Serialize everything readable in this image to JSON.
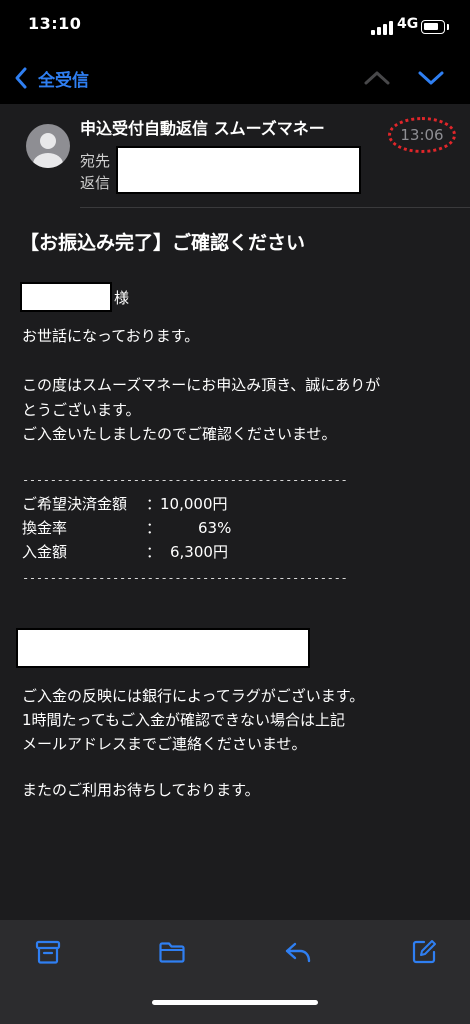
{
  "status_bar": {
    "time": "13:10",
    "network": "4G"
  },
  "nav": {
    "back_label": "全受信",
    "up_icon": "chevron-up-icon",
    "down_icon": "chevron-down-icon"
  },
  "header": {
    "sender": "申込受付自動返信 スムーズマネー",
    "time": "13:06",
    "to_label": "宛先",
    "reply_label": "返信"
  },
  "message": {
    "subject": "【お振込み完了】ご確認ください",
    "honorific": "様",
    "greeting": "お世話になっております。",
    "thanks_line1": "この度はスムーズマネーにお申込み頂き、誠にありが",
    "thanks_line2": "とうございます。",
    "confirm_line": "ご入金いたしましたのでご確認くださいませ。",
    "separator": "-----------------------------------------------",
    "details": [
      {
        "label": "ご希望決済金額",
        "value": "10,000円"
      },
      {
        "label": "換金率",
        "value": "63%"
      },
      {
        "label": "入金額",
        "value": "6,300円"
      }
    ],
    "detail_colon": "：",
    "note_line1": "ご入金の反映には銀行によってラグがございます。",
    "note_line2": "1時間たってもご入金が確認できない場合は上記",
    "note_line3": "メールアドレスまでご連絡くださいませ。",
    "closing": "またのご利用お待ちしております。"
  },
  "toolbar": {
    "icons": [
      "archive-icon",
      "folder-icon",
      "reply-icon",
      "compose-icon"
    ]
  },
  "colors": {
    "accent": "#2f7ff2",
    "background": "#1c1c1e",
    "bar": "#000000",
    "toolbar": "#2c2c2e",
    "highlight": "#e0262a"
  }
}
